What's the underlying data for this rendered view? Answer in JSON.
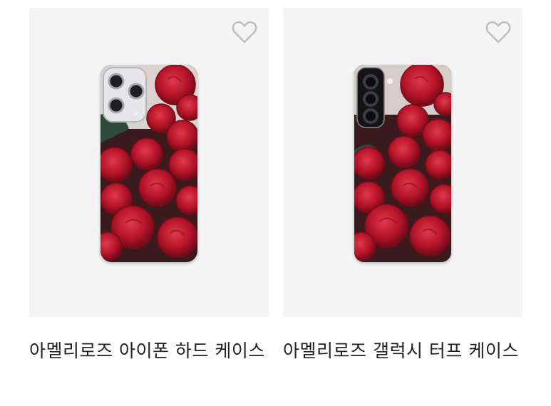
{
  "products": [
    {
      "name": "아멜리로즈 아이폰 하드 케이스",
      "wishlist_icon": "heart-outline-icon",
      "image_alt": "red roses iphone case"
    },
    {
      "name": "아멜리로즈 갤럭시 터프 케이스",
      "wishlist_icon": "heart-outline-icon",
      "image_alt": "red roses galaxy case"
    }
  ],
  "colors": {
    "thumb_bg": "#f4f4f4",
    "heart_stroke": "#bdbdbd",
    "rose": "#c0182c",
    "title_text": "#222222"
  }
}
